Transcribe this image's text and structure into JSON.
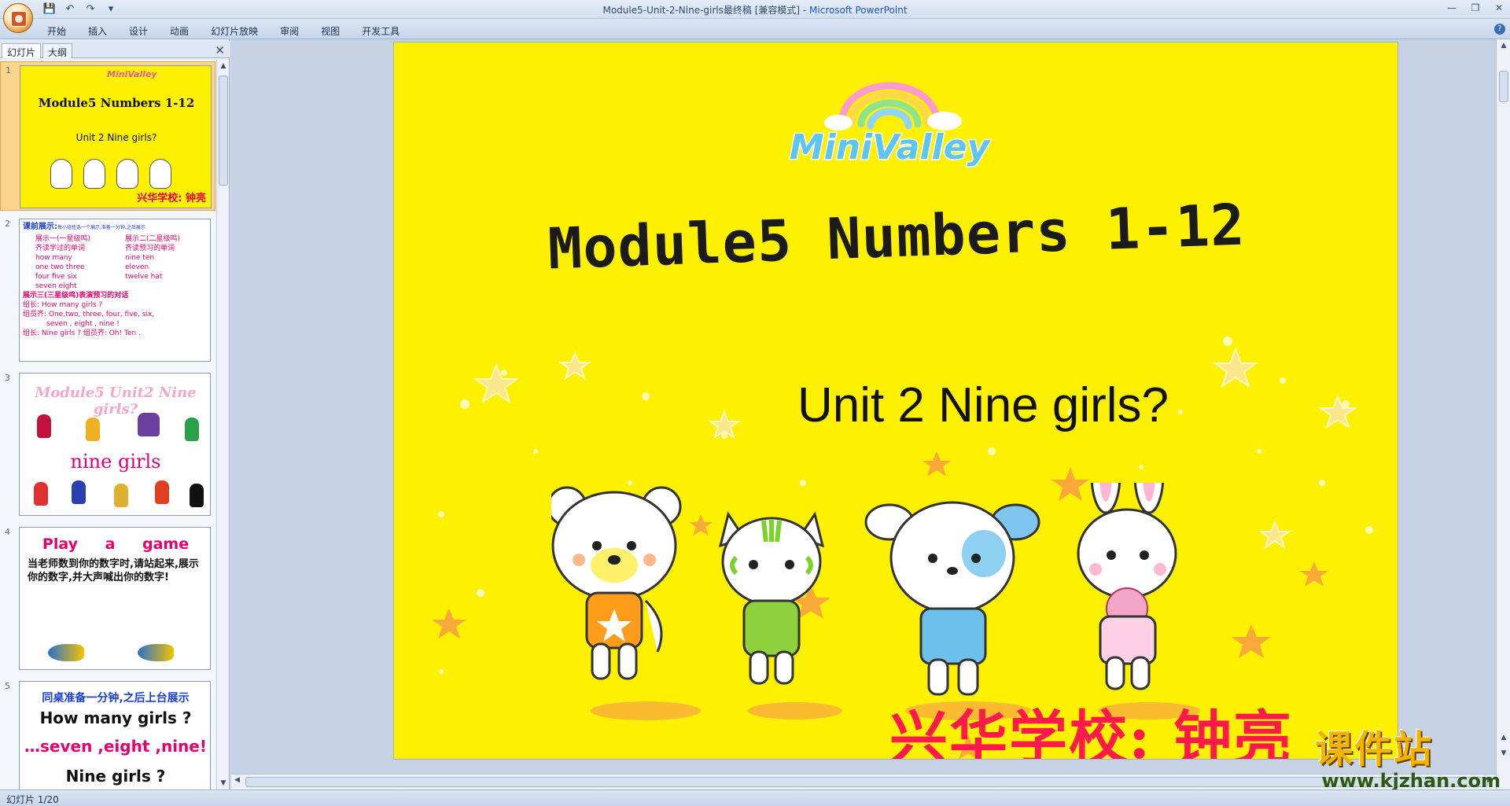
{
  "window": {
    "title": "Module5-Unit-2-Nine-girls最终稿 [兼容模式] - ",
    "app_name": "Microsoft PowerPoint",
    "accent": "#1a56c8"
  },
  "quick_access": [
    "save-icon",
    "undo-icon",
    "redo-icon",
    "customize-icon"
  ],
  "ribbon": {
    "tabs": [
      "开始",
      "插入",
      "设计",
      "动画",
      "幻灯片放映",
      "审阅",
      "视图",
      "开发工具"
    ]
  },
  "left_pane": {
    "tabs": [
      "幻灯片",
      "大纲"
    ],
    "active_tab": "幻灯片",
    "slides": [
      {
        "number": "1",
        "logo": "MiniValley",
        "title": "Module5 Numbers 1-12",
        "subtitle": "Unit 2 Nine girls?",
        "signature": "兴华学校: 钟亮"
      },
      {
        "number": "2",
        "header": "课前展示:",
        "header_note": "每小组任选一个展示,准备一分钟,之后展示",
        "col1": [
          "展示一(一星级鸣)",
          "齐读学过的单词",
          "how many",
          "one two three",
          "four five six",
          "seven eight"
        ],
        "col2": [
          "展示二(二星级鸣)",
          "齐读预习的单词",
          "nine ten",
          "eleven",
          "twelve hat"
        ],
        "show3": "展示三(三星级鸣)表演预习的对话",
        "dialog": [
          "组长: How many girls ?",
          "组员齐: One,two, three, four, five, six,",
          "seven , eight , nine !",
          "组长: Nine girls ? 组员齐: Oh! Ten ."
        ]
      },
      {
        "number": "3",
        "title": "Module5 Unit2 Nine girls?",
        "word": "nine girls"
      },
      {
        "number": "4",
        "title": "Play a game",
        "body": "当老师数到你的数字时,请站起来,展示你的数字,并大声喊出你的数字!"
      },
      {
        "number": "5",
        "lines": [
          "同桌准备一分钟,之后上台展示",
          "How many girls ?",
          "…seven ,eight ,nine!",
          "Nine girls ?"
        ]
      }
    ]
  },
  "slide": {
    "logo": "MiniValley",
    "title": "Module5 Numbers 1-12",
    "subtitle": "Unit 2 Nine girls?",
    "signature": "兴华学校: 钟亮",
    "background": "#fdf000"
  },
  "watermark": {
    "text": "课件站",
    "url": "www.kjzhan.com"
  },
  "status": {
    "slide_info": "幻灯片 1/20"
  }
}
